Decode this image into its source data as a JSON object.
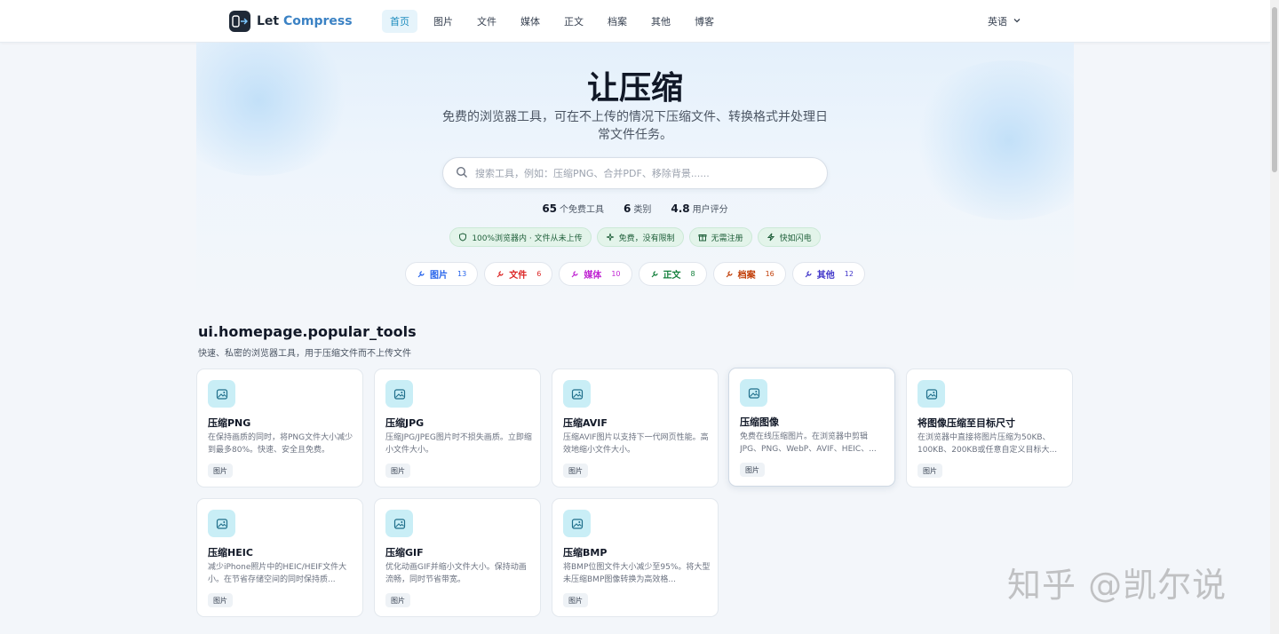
{
  "header": {
    "logo_word": "Let",
    "logo_accent": "Compress",
    "nav": [
      {
        "label": "首页",
        "active": true
      },
      {
        "label": "图片",
        "active": false
      },
      {
        "label": "文件",
        "active": false
      },
      {
        "label": "媒体",
        "active": false
      },
      {
        "label": "正文",
        "active": false
      },
      {
        "label": "档案",
        "active": false
      },
      {
        "label": "其他",
        "active": false
      },
      {
        "label": "博客",
        "active": false
      }
    ],
    "language": "英语"
  },
  "hero": {
    "title": "让压缩",
    "subtitle": "免费的浏览器工具，可在不上传的情况下压缩文件、转换格式并处理日常文件任务。",
    "search_placeholder": "搜索工具，例如：压缩PNG、合并PDF、移除背景......",
    "stats": [
      {
        "value": "65",
        "label": "个免费工具"
      },
      {
        "value": "6",
        "label": "类别"
      },
      {
        "value": "4.8",
        "label": "用户评分"
      }
    ],
    "badges": [
      {
        "icon": "shield-icon",
        "label": "100%浏览器内 · 文件从未上传"
      },
      {
        "icon": "sparkle-icon",
        "label": "免费，没有限制"
      },
      {
        "icon": "gift-icon",
        "label": "无需注册"
      },
      {
        "icon": "lightning-icon",
        "label": "快如闪电"
      }
    ],
    "categories": [
      {
        "label": "图片",
        "count": "13",
        "color": "#2563eb"
      },
      {
        "label": "文件",
        "count": "6",
        "color": "#dc2626"
      },
      {
        "label": "媒体",
        "count": "10",
        "color": "#c026d3"
      },
      {
        "label": "正文",
        "count": "8",
        "color": "#15803d"
      },
      {
        "label": "档案",
        "count": "16",
        "color": "#c2410c"
      },
      {
        "label": "其他",
        "count": "12",
        "color": "#4338ca"
      }
    ]
  },
  "popular": {
    "title": "ui.homepage.popular_tools",
    "subtitle": "快速、私密的浏览器工具，用于压缩文件而不上传文件",
    "tools": [
      {
        "title": "压缩PNG",
        "desc": "在保持画质的同时，将PNG文件大小减少到最多80%。快速、安全且免费。",
        "tag": "图片"
      },
      {
        "title": "压缩JPG",
        "desc": "压缩JPG/JPEG图片时不损失画质。立即缩小文件大小。",
        "tag": "图片"
      },
      {
        "title": "压缩AVIF",
        "desc": "压缩AVIF图片以支持下一代网页性能。高效地缩小文件大小。",
        "tag": "图片"
      },
      {
        "title": "压缩图像",
        "desc": "免费在线压缩图片。在浏览器中剪辑JPG、PNG、WebP、AVIF、HEIC、...",
        "tag": "图片"
      },
      {
        "title": "将图像压缩至目标尺寸",
        "desc": "在浏览器中直接将图片压缩为50KB、100KB、200KB或任意自定义目标大...",
        "tag": "图片"
      },
      {
        "title": "压缩HEIC",
        "desc": "减少iPhone照片中的HEIC/HEIF文件大小。在节省存储空间的同时保持质...",
        "tag": "图片"
      },
      {
        "title": "压缩GIF",
        "desc": "优化动画GIF并缩小文件大小。保持动画流畅，同时节省带宽。",
        "tag": "图片"
      },
      {
        "title": "压缩BMP",
        "desc": "将BMP位图文件大小减少至95%。将大型未压缩BMP图像转换为高效格...",
        "tag": "图片"
      }
    ]
  },
  "watermark": "知乎 @凯尔说"
}
